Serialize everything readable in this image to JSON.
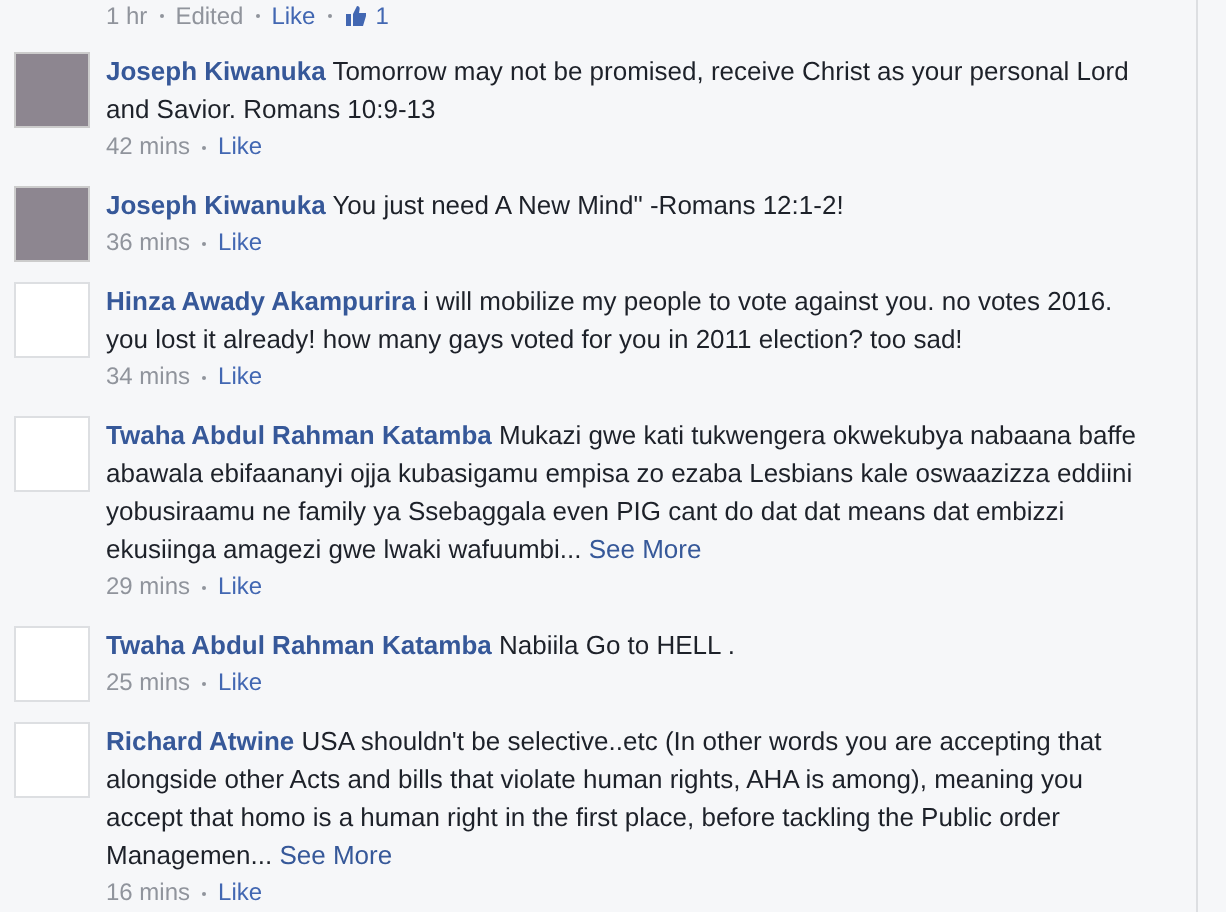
{
  "previous_comment_footer": {
    "time": "1 hr",
    "edited": "Edited",
    "like": "Like",
    "like_count": "1"
  },
  "comments": [
    {
      "author": "Joseph Kiwanuka",
      "kind": "photo",
      "text": "Tomorrow may not be promised, receive Christ as your personal Lord and Savior. Romans 10:9-13",
      "time": "42 mins",
      "like": "Like"
    },
    {
      "author": "Joseph Kiwanuka",
      "kind": "photo",
      "text": "You just need A New Mind\" -Romans 12:1-2!",
      "time": "36 mins",
      "like": "Like"
    },
    {
      "author": "Hinza Awady Akampurira",
      "kind": "blank",
      "text": "i will mobilize my people to vote against you. no votes 2016. you lost it already! how many gays voted for you in 2011 election? too sad!",
      "time": "34 mins",
      "like": "Like"
    },
    {
      "author": "Twaha Abdul Rahman Katamba",
      "kind": "blank",
      "text": "Mukazi gwe kati tukwengera okwekubya nabaana baffe abawala ebifaananyi ojja kubasigamu empisa zo ezaba Lesbians kale oswaazizza eddiini yobusiraamu ne family ya Ssebaggala even PIG cant do dat dat means dat embizzi ekusiinga amagezi gwe lwaki wafuumbi...",
      "see_more": "See More",
      "time": "29 mins",
      "like": "Like"
    },
    {
      "author": "Twaha Abdul Rahman Katamba",
      "kind": "blank",
      "text": "Nabiila Go to HELL .",
      "time": "25 mins",
      "like": "Like"
    },
    {
      "author": "Richard Atwine",
      "kind": "blank",
      "text": "USA shouldn't be selective..etc (In other words you are accepting that alongside other Acts and bills that violate human rights, AHA is among), meaning you accept that homo is a human right in the first place, before tackling the Public order Managemen...",
      "see_more": "See More",
      "time": "16 mins",
      "like": "Like"
    }
  ]
}
